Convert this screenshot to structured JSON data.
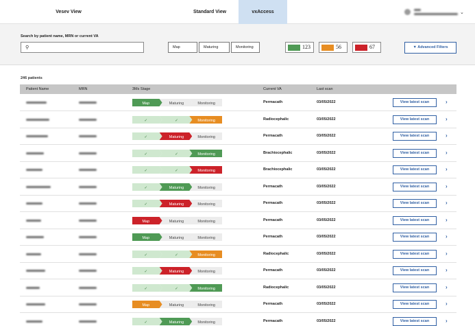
{
  "nav": {
    "tabs": [
      {
        "label": "Vesev View",
        "active": false
      },
      {
        "label": "Standard View",
        "active": false
      },
      {
        "label": "vxAccess",
        "active": true
      }
    ]
  },
  "filters": {
    "search_label": "Search by patient name, MRN or current VA",
    "search_value": "",
    "stages": [
      "Map",
      "Maturing",
      "Monitoring"
    ],
    "counts": [
      {
        "value": "123",
        "color": "#4f9a55"
      },
      {
        "value": "56",
        "color": "#e78d22"
      },
      {
        "value": "67",
        "color": "#cc2229"
      }
    ],
    "advanced_label": "Advanced Filters"
  },
  "table": {
    "count_label": "246 patients",
    "headers": [
      "Patient Name",
      "MRN",
      "3Ms Stage",
      "Current VA",
      "Last scan"
    ],
    "stage_labels": [
      "Map",
      "Maturing",
      "Monitoring"
    ],
    "check_glyph": "✓",
    "view_label": "View latest scan",
    "rows": [
      {
        "stage": 0,
        "color": "green",
        "va": "Permacath",
        "date": "03/05/2022"
      },
      {
        "stage": 2,
        "color": "orange",
        "va": "Radiocephalic",
        "date": "03/05/2022"
      },
      {
        "stage": 1,
        "color": "red",
        "va": "Permacath",
        "date": "03/05/2022"
      },
      {
        "stage": 2,
        "color": "green",
        "va": "Brachiocephalic",
        "date": "03/05/2022"
      },
      {
        "stage": 2,
        "color": "red",
        "va": "Brachiocephalic",
        "date": "03/05/2022"
      },
      {
        "stage": 1,
        "color": "green",
        "va": "Permacath",
        "date": "03/05/2022"
      },
      {
        "stage": 1,
        "color": "red",
        "va": "Permacath",
        "date": "03/05/2022"
      },
      {
        "stage": 0,
        "color": "red",
        "va": "Permacath",
        "date": "03/05/2022"
      },
      {
        "stage": 0,
        "color": "green",
        "va": "Permacath",
        "date": "03/05/2022"
      },
      {
        "stage": 2,
        "color": "orange",
        "va": "Radiocephalic",
        "date": "03/05/2022"
      },
      {
        "stage": 1,
        "color": "red",
        "va": "Permacath",
        "date": "03/05/2022"
      },
      {
        "stage": 2,
        "color": "green",
        "va": "Radiocephalic",
        "date": "03/05/2022"
      },
      {
        "stage": 0,
        "color": "orange",
        "va": "Permacath",
        "date": "03/05/2022"
      },
      {
        "stage": 1,
        "color": "green",
        "va": "Permacath",
        "date": "03/05/2022"
      }
    ]
  },
  "colors": {
    "green": "#4f9a55",
    "orange": "#e78d22",
    "red": "#cc2229",
    "done": "#cfe8cf",
    "pending": "#ececec",
    "accent": "#2f5fa3"
  },
  "icons": {
    "search": "search-icon",
    "row_action": "chevron-right-icon",
    "account": "chevron-down-icon",
    "filter": "filter-icon"
  }
}
